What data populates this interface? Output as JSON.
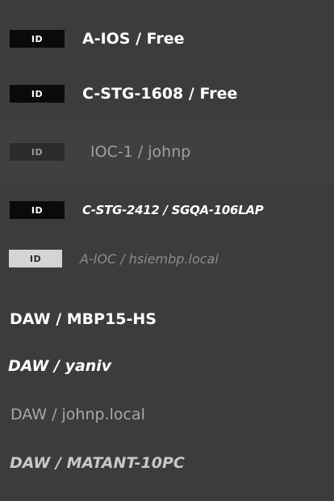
{
  "devices": [
    {
      "badge": "ID",
      "label": "A-IOS / Free"
    },
    {
      "badge": "ID",
      "label": "C-STG-1608 / Free"
    },
    {
      "badge": "ID",
      "label": "IOC-1 / johnp"
    },
    {
      "badge": "ID",
      "label": "C-STG-2412 / SGQA-106LAP"
    },
    {
      "badge": "ID",
      "label": "A-IOC / hsiembp.local"
    }
  ],
  "daw_items": [
    {
      "label": "DAW / MBP15-HS"
    },
    {
      "label": "DAW / yaniv"
    },
    {
      "label": "DAW / johnp.local"
    },
    {
      "label": "DAW / MATANT-10PC"
    }
  ],
  "colors": {
    "background": "#3c3c3c",
    "badge_dark": "#0a0a0a",
    "badge_dim": "#2b2b2b",
    "badge_light": "#d4d4d4",
    "text_primary": "#ffffff",
    "text_secondary": "#a0a0a0"
  }
}
